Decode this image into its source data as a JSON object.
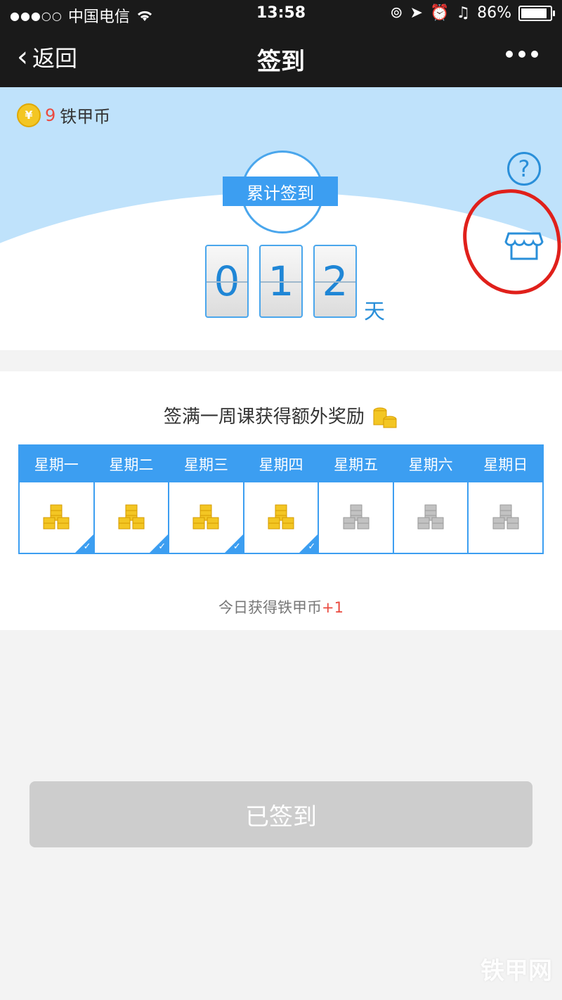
{
  "status": {
    "signal": "●●●○○",
    "carrier": "中国电信",
    "time": "13:58",
    "battery": "86%"
  },
  "nav": {
    "back": "返回",
    "title": "签到"
  },
  "balance": {
    "amount": "9",
    "unit": "铁甲币",
    "coin_symbol": "¥"
  },
  "hero": {
    "badge": "累计签到",
    "digits": [
      "0",
      "1",
      "2"
    ],
    "unit": "天",
    "help": "?"
  },
  "week": {
    "heading": "签满一周课获得额外奖励",
    "days": [
      {
        "label": "星期一",
        "checked": true
      },
      {
        "label": "星期二",
        "checked": true
      },
      {
        "label": "星期三",
        "checked": true
      },
      {
        "label": "星期四",
        "checked": true
      },
      {
        "label": "星期五",
        "checked": false
      },
      {
        "label": "星期六",
        "checked": false
      },
      {
        "label": "星期日",
        "checked": false
      }
    ],
    "today_text": "今日获得铁甲币",
    "today_amount": "+1"
  },
  "button": {
    "label": "已签到"
  },
  "watermark": "铁甲网",
  "colors": {
    "accent": "#3c9ef1",
    "coin": "#f3c623",
    "inactive_coin": "#c2c2c2",
    "annotation": "#e0201b"
  }
}
